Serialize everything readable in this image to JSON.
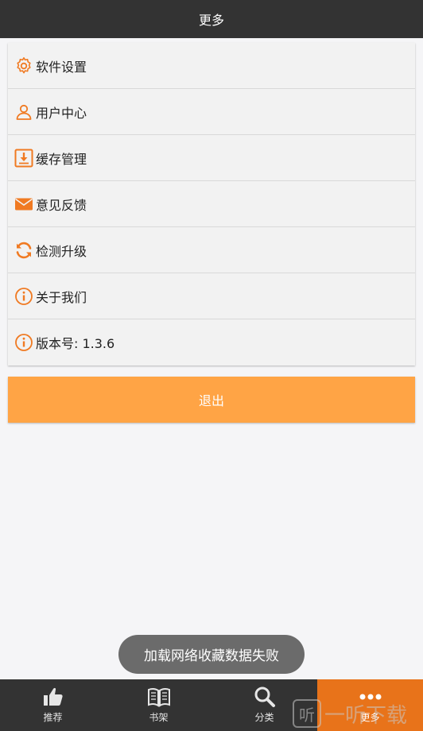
{
  "header": {
    "title": "更多"
  },
  "menu": {
    "items": [
      {
        "label": "软件设置",
        "icon": "gear-icon"
      },
      {
        "label": "用户中心",
        "icon": "user-icon"
      },
      {
        "label": "缓存管理",
        "icon": "download-box-icon"
      },
      {
        "label": "意见反馈",
        "icon": "envelope-icon"
      },
      {
        "label": "检测升级",
        "icon": "refresh-icon"
      },
      {
        "label": "关于我们",
        "icon": "info-icon"
      },
      {
        "label": "版本号: 1.3.6",
        "icon": "info-icon"
      }
    ]
  },
  "logout": {
    "label": "退出"
  },
  "toast": {
    "message": "加载网络收藏数据失败"
  },
  "tabbar": {
    "tabs": [
      {
        "label": "推荐",
        "icon": "thumbs-up-icon"
      },
      {
        "label": "书架",
        "icon": "book-icon"
      },
      {
        "label": "分类",
        "icon": "search-icon"
      },
      {
        "label": "更多",
        "icon": "more-dots-icon",
        "active": true
      }
    ]
  },
  "watermark": {
    "text": "一听下载",
    "glyph": "听"
  },
  "colors": {
    "titlebar": "#333333",
    "accent_orange": "#e8731a",
    "icon_orange": "#f07a22",
    "logout_button": "#ffa445",
    "tabbar": "#333333"
  }
}
